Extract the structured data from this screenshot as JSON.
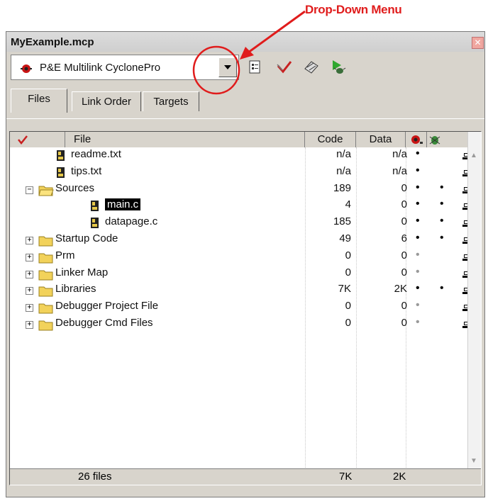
{
  "annotation": {
    "label": "Drop-Down Menu",
    "color": "#e01c1c"
  },
  "window": {
    "title": "MyExample.mcp"
  },
  "toolbar": {
    "target_value": "P&E Multilink CyclonePro"
  },
  "tabs": [
    "Files",
    "Link Order",
    "Targets"
  ],
  "columns": {
    "file": "File",
    "code": "Code",
    "data": "Data"
  },
  "rows": [
    {
      "name": "readme.txt",
      "code": "n/a",
      "data": "n/a",
      "d1": "•",
      "d2": ""
    },
    {
      "name": "tips.txt",
      "code": "n/a",
      "data": "n/a",
      "d1": "•",
      "d2": ""
    },
    {
      "name": "Sources",
      "code": "189",
      "data": "0",
      "d1": "•",
      "d2": "•"
    },
    {
      "name": "main.c",
      "code": "4",
      "data": "0",
      "d1": "•",
      "d2": "•"
    },
    {
      "name": "datapage.c",
      "code": "185",
      "data": "0",
      "d1": "•",
      "d2": "•"
    },
    {
      "name": "Startup Code",
      "code": "49",
      "data": "6",
      "d1": "•",
      "d2": "•"
    },
    {
      "name": "Prm",
      "code": "0",
      "data": "0",
      "d1": "•",
      "d2": ""
    },
    {
      "name": "Linker Map",
      "code": "0",
      "data": "0",
      "d1": "•",
      "d2": ""
    },
    {
      "name": "Libraries",
      "code": "7K",
      "data": "2K",
      "d1": "•",
      "d2": "•"
    },
    {
      "name": "Debugger Project File",
      "code": "0",
      "data": "0",
      "d1": "•",
      "d2": ""
    },
    {
      "name": "Debugger Cmd Files",
      "code": "0",
      "data": "0",
      "d1": "•",
      "d2": ""
    }
  ],
  "footer": {
    "count": "26 files",
    "code_total": "7K",
    "data_total": "2K"
  }
}
